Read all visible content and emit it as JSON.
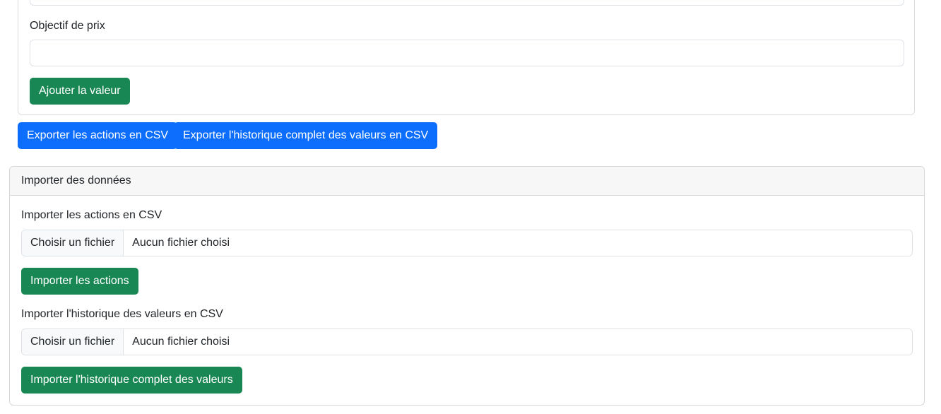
{
  "add_form": {
    "price_target_label": "Objectif de prix",
    "price_target_value": "",
    "add_button": "Ajouter la valeur"
  },
  "export": {
    "actions_csv_button": "Exporter les actions en CSV",
    "history_csv_button": "Exporter l'historique complet des valeurs en CSV"
  },
  "import": {
    "header": "Importer des données",
    "actions": {
      "label": "Importer les actions en CSV",
      "file_button": "Choisir un fichier",
      "file_status": "Aucun fichier choisi",
      "submit_button": "Importer les actions"
    },
    "history": {
      "label": "Importer l'historique des valeurs en CSV",
      "file_button": "Choisir un fichier",
      "file_status": "Aucun fichier choisi",
      "submit_button": "Importer l'historique complet des valeurs"
    }
  },
  "colors": {
    "success": "#198754",
    "primary": "#0d6efd"
  }
}
